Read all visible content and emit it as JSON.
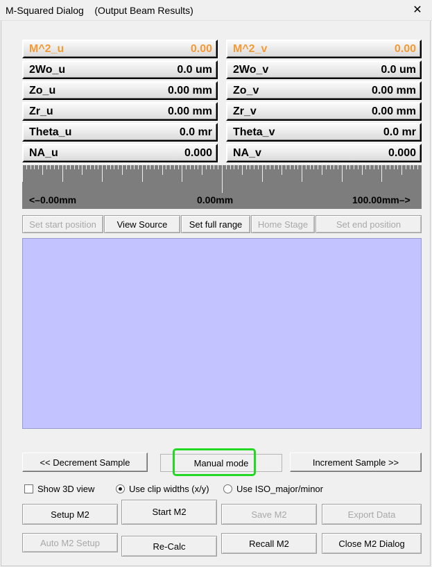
{
  "window": {
    "title": "M-Squared Dialog    (Output Beam Results)",
    "close_glyph": "✕"
  },
  "results": {
    "left": [
      {
        "label": "M^2_u",
        "value": "0.00"
      },
      {
        "label": "2Wo_u",
        "value": "0.0 um"
      },
      {
        "label": "Zo_u",
        "value": "0.00 mm"
      },
      {
        "label": "Zr_u",
        "value": "0.00 mm"
      },
      {
        "label": "Theta_u",
        "value": "0.0 mr"
      },
      {
        "label": "NA_u",
        "value": "0.000"
      }
    ],
    "right": [
      {
        "label": "M^2_v",
        "value": "0.00"
      },
      {
        "label": "2Wo_v",
        "value": "0.0 um"
      },
      {
        "label": "Zo_v",
        "value": "0.00 mm"
      },
      {
        "label": "Zr_v",
        "value": "0.00 mm"
      },
      {
        "label": "Theta_v",
        "value": "0.0 mr"
      },
      {
        "label": "NA_v",
        "value": "0.000"
      }
    ]
  },
  "ruler": {
    "left_label": "<–0.00mm",
    "center_label": "0.00mm",
    "right_label": "100.00mm–>"
  },
  "stage_buttons": {
    "set_start": "Set start position",
    "view_source": "View Source",
    "set_full_range": "Set full range",
    "home_stage": "Home Stage",
    "set_end": "Set end position"
  },
  "sample_controls": {
    "decrement": "<< Decrement Sample",
    "mode": "Manual mode",
    "increment": "Increment Sample >>"
  },
  "options": {
    "show_3d": "Show 3D view",
    "clip_widths": "Use clip widths (x/y)",
    "iso": "Use ISO_major/minor",
    "show_3d_checked": false,
    "clip_selected": true
  },
  "actions_row1": {
    "setup": "Setup M2",
    "start": "Start M2",
    "save": "Save M2",
    "export": "Export Data"
  },
  "actions_row2": {
    "auto_setup": "Auto M2 Setup",
    "recalc": "Re-Calc",
    "recall": "Recall  M2",
    "close": "Close M2 Dialog"
  },
  "colors": {
    "plot_background": "#c3c3ff",
    "highlight_accent": "#22d822",
    "m2_label_color": "#f39a34"
  }
}
